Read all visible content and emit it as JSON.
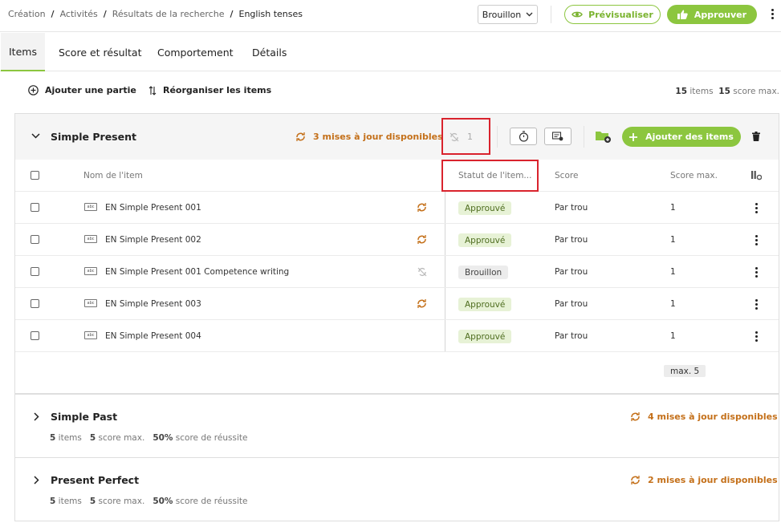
{
  "breadcrumb": [
    "Création",
    "Activités",
    "Résultats de la recherche",
    "English tenses"
  ],
  "header": {
    "status_value": "Brouillon",
    "preview_label": "Prévisualiser",
    "approve_label": "Approuver"
  },
  "tabs": [
    "Items",
    "Score et résultat",
    "Comportement",
    "Détails"
  ],
  "toolbar": {
    "add_part_label": "Ajouter une partie",
    "reorganize_label": "Réorganiser les items",
    "items_count": "15",
    "items_word": "items",
    "score_count": "15",
    "score_word": "score max."
  },
  "section1": {
    "title": "Simple Present",
    "updates_label": "3 mises à jour disponibles",
    "linked_count": "1",
    "add_items_label": "Ajouter des items",
    "columns": {
      "name": "Nom de l'item",
      "status": "Statut de l'item...",
      "score": "Score",
      "max_score": "Score max."
    },
    "rows": [
      {
        "name": "EN Simple Present 001",
        "status": "Approuvé",
        "score": "Par trou",
        "max": "1",
        "update": "available"
      },
      {
        "name": "EN Simple Present 002",
        "status": "Approuvé",
        "score": "Par trou",
        "max": "1",
        "update": "available"
      },
      {
        "name": "EN Simple Present 001 Competence writing",
        "status": "Brouillon",
        "score": "Par trou",
        "max": "1",
        "update": "unlinked"
      },
      {
        "name": "EN Simple Present 003",
        "status": "Approuvé",
        "score": "Par trou",
        "max": "1",
        "update": "available"
      },
      {
        "name": "EN Simple Present 004",
        "status": "Approuvé",
        "score": "Par trou",
        "max": "1",
        "update": "none"
      }
    ],
    "max_total": "max. 5",
    "item_icon_text": "abc"
  },
  "section2": {
    "title": "Simple Past",
    "updates_label": "4 mises à jour disponibles",
    "items": "5",
    "items_word": "items",
    "score": "5",
    "score_word": "score max.",
    "pass": "50%",
    "pass_word": "score de réussite"
  },
  "section3": {
    "title": "Present Perfect",
    "updates_label": "2 mises à jour disponibles",
    "items": "5",
    "items_word": "items",
    "score": "5",
    "score_word": "score max.",
    "pass": "50%",
    "pass_word": "score de réussite"
  },
  "colors": {
    "accent": "#8cc63f",
    "update": "#c4701a",
    "highlight": "#d9232d"
  }
}
